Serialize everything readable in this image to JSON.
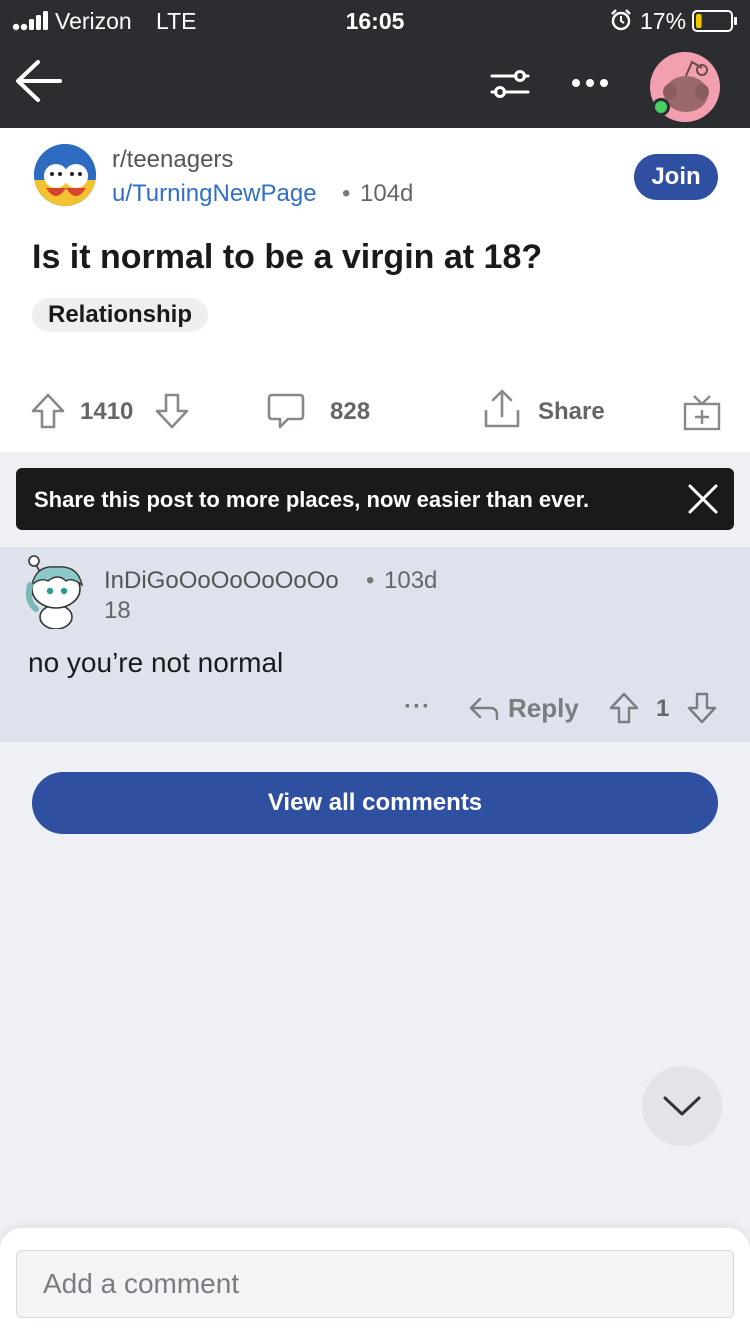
{
  "status_bar": {
    "carrier": "Verizon",
    "network": "LTE",
    "time": "16:05",
    "battery": "17%",
    "battery_level": 0.17,
    "icons": [
      "signal-icon",
      "alarm-icon",
      "battery-icon"
    ]
  },
  "nav": {
    "icons": [
      "back-arrow-icon",
      "filter-icon",
      "more-icon",
      "profile-avatar"
    ],
    "online_color": "#46d160"
  },
  "post": {
    "subreddit": "r/teenagers",
    "author": "u/TurningNewPage",
    "separator": "•",
    "age": "104d",
    "join_label": "Join",
    "title": "Is it normal to be a virgin at 18?",
    "flair": "Relationship",
    "score": "1410",
    "comments": "828",
    "share_label": "Share"
  },
  "toast": {
    "message": "Share this post to more places, now easier than ever."
  },
  "comment": {
    "author": "InDiGoOoOoOoOoOo",
    "separator": "•",
    "age": "103d",
    "karma": "18",
    "body": "no you’re not normal",
    "more_label": "···",
    "reply_label": "Reply",
    "score": "1"
  },
  "view_all_label": "View all comments",
  "composer": {
    "placeholder": "Add a comment"
  },
  "colors": {
    "brand_blue": "#2f4fa0",
    "link_blue": "#2f6fc5",
    "dark_bar": "#2b2d30",
    "comment_bg": "#dde2ec"
  }
}
